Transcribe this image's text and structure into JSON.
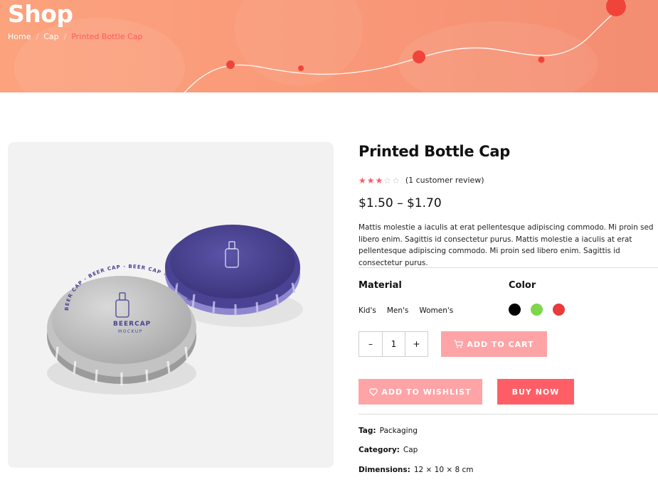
{
  "hero": {
    "title": "Shop",
    "breadcrumb": [
      "Home",
      "Cap",
      "Printed Bottle Cap"
    ],
    "separator": "/"
  },
  "product": {
    "title": "Printed Bottle Cap",
    "rating": 3,
    "rating_max": 5,
    "review_text": "(1 customer review)",
    "price": "$1.50 – $1.70",
    "description": "Mattis molestie a iaculis at erat pellentesque adipiscing commodo. Mi proin sed libero enim. Sagittis id consectetur purus. Mattis molestie a iaculis at erat pellentesque adipiscing commodo. Mi proin sed libero enim. Sagittis id consectetur purus.",
    "image_text": {
      "line1": "BEERCAP",
      "line2": "MOCKUP",
      "ring": "BEER CAP · BEER CAP · BEER CAP · BEER CAP ·"
    }
  },
  "attributes": {
    "material_label": "Material",
    "materials": [
      "Kid's",
      "Men's",
      "Women's"
    ],
    "color_label": "Color",
    "colors": [
      "#000000",
      "#7ed64b",
      "#e83b3b"
    ]
  },
  "quantity": {
    "minus": "–",
    "value": "1",
    "plus": "+"
  },
  "actions": {
    "add_to_cart": "ADD TO CART",
    "add_to_wishlist": "ADD TO WISHLIST",
    "buy_now": "BUY NOW"
  },
  "meta": {
    "tag_label": "Tag:",
    "tag_value": "Packaging",
    "category_label": "Category:",
    "category_value": "Cap",
    "dimensions_label": "Dimensions:",
    "dimensions_value": "12 × 10 × 8 cm"
  },
  "colors": {
    "accent": "#ff5e66",
    "accent_light": "#ffa4a6",
    "hero_start": "#fca27d",
    "hero_end": "#f48d72"
  }
}
